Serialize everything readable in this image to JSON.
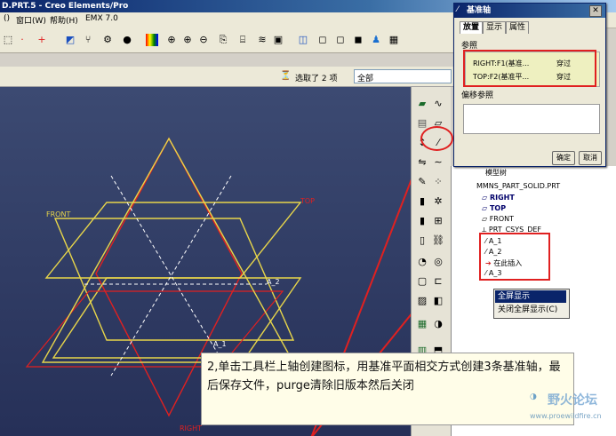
{
  "window": {
    "title": "D.PRT.5 - Creo Elements/Pro"
  },
  "menubar": {
    "items": [
      "()",
      "窗口(W)",
      "帮助(H)",
      "EMX 7.0"
    ]
  },
  "filter": {
    "selected_text": "选取了 2 项",
    "dropdown_value": "全部"
  },
  "graphics": {
    "labels": {
      "front": "FRONT",
      "top": "TOP",
      "right": "RIGHT",
      "axis2": "A_2",
      "axis1": "A_1"
    }
  },
  "dialog": {
    "title": "基准轴",
    "tabs": [
      "放置",
      "显示",
      "属性"
    ],
    "ref_label": "参照",
    "refs": [
      {
        "name": "RIGHT:F1(基准...",
        "mode": "穿过"
      },
      {
        "name": "TOP:F2(基准平...",
        "mode": "穿过"
      }
    ],
    "offset_label": "偏移参照",
    "ok": "确定",
    "cancel": "取消"
  },
  "model_tree": {
    "header": "模型树",
    "items": [
      "MMNS_PART_SOLID.PRT",
      "RIGHT",
      "TOP",
      "FRONT",
      "PRT_CSYS_DEF",
      "A_1",
      "A_2",
      "在此插入",
      "A_3"
    ]
  },
  "context_menu": {
    "items": [
      "全屏显示",
      "关闭全屏显示(C)"
    ]
  },
  "annotation": {
    "text": "2,单击工具栏上轴创建图标，用基准平面相交方式创建3条基准轴，最后保存文件，purge清除旧版本然后关闭"
  },
  "watermark": {
    "brand": "野火论坛",
    "url": "www.proewildfire.cn"
  },
  "colors": {
    "accent_red": "#e02020",
    "datum_yellow": "#e8d64a",
    "graphics_bg": "#2b3560"
  }
}
